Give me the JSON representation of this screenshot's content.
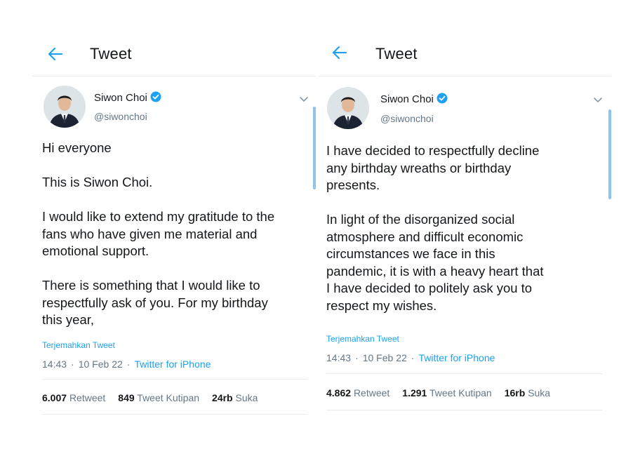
{
  "colors": {
    "accent": "#1da1f2",
    "text": "#14171a",
    "muted": "#657786",
    "border": "#e6ecf0",
    "scroll": "#8ec4ec"
  },
  "left": {
    "header": {
      "title": "Tweet",
      "back_icon": "arrow-left-icon"
    },
    "author": {
      "name": "Siwon Choi",
      "handle": "@siwonchoi",
      "verified_icon": "verified-badge-icon"
    },
    "paragraphs": [
      [
        "Hi everyone"
      ],
      [
        "This is Siwon Choi."
      ],
      [
        "I would like to extend my gratitude to the",
        "fans who have given me material and",
        "emotional support."
      ],
      [
        "There is something that I would like to",
        "respectfully ask of you. For my birthday",
        "this year,"
      ]
    ],
    "translate": "Terjemahkan Tweet",
    "meta": {
      "time": "14:43",
      "sep": "·",
      "date": "10 Feb 22",
      "source": "Twitter for iPhone"
    },
    "stats": {
      "retweets_count": "6.007",
      "retweets_label": "Retweet",
      "quotes_count": "849",
      "quotes_label": "Tweet Kutipan",
      "likes_count": "24rb",
      "likes_label": "Suka"
    }
  },
  "right": {
    "header": {
      "title": "Tweet",
      "back_icon": "arrow-left-icon"
    },
    "author": {
      "name": "Siwon Choi",
      "handle": "@siwonchoi",
      "verified_icon": "verified-badge-icon"
    },
    "paragraphs": [
      [
        "I have decided to respectfully decline",
        "any birthday wreaths or birthday",
        "presents."
      ],
      [
        "In light of the disorganized social",
        "atmosphere and difficult economic",
        "circumstances we face in this",
        "pandemic, it is with a heavy heart that",
        "I have decided to politely ask you to",
        "respect my wishes."
      ]
    ],
    "translate": "Terjemahkan Tweet",
    "meta": {
      "time": "14:43",
      "sep": "·",
      "date": "10 Feb 22",
      "source": "Twitter for iPhone"
    },
    "stats": {
      "retweets_count": "4.862",
      "retweets_label": "Retweet",
      "quotes_count": "1.291",
      "quotes_label": "Tweet Kutipan",
      "likes_count": "16rb",
      "likes_label": "Suka"
    }
  }
}
